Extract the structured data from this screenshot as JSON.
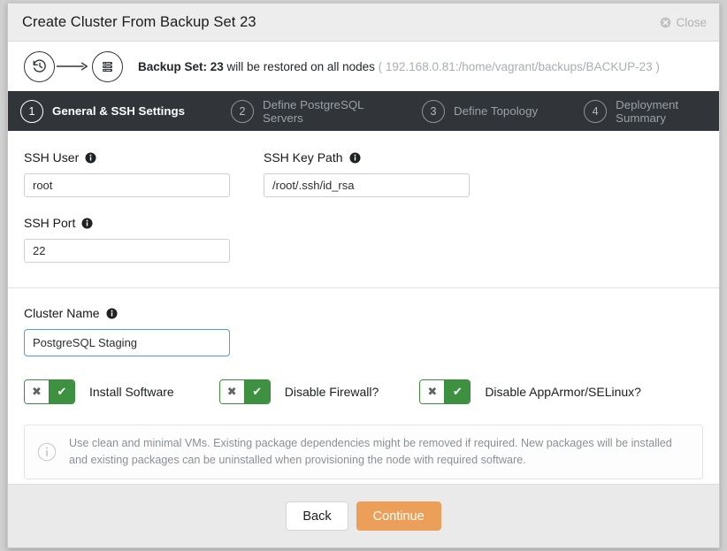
{
  "window": {
    "title": "Create Cluster From Backup Set 23",
    "close_label": "Close",
    "close_icon": "close-circle-icon"
  },
  "banner": {
    "restore_icon": "history-restore-icon",
    "server_icon": "server-stack-icon",
    "arrow_icon": "arrow-right-icon",
    "prefix": "Backup Set: 23",
    "middle": " will be restored on all nodes ",
    "path": "( 192.168.0.81:/home/vagrant/backups/BACKUP-23 )"
  },
  "steps": [
    {
      "num": "1",
      "label": "General & SSH Settings",
      "active": true
    },
    {
      "num": "2",
      "label": "Define PostgreSQL Servers",
      "active": false
    },
    {
      "num": "3",
      "label": "Define Topology",
      "active": false
    },
    {
      "num": "4",
      "label": "Deployment Summary",
      "active": false
    }
  ],
  "form": {
    "ssh_user": {
      "label": "SSH User",
      "value": "root",
      "info_icon": "info-icon"
    },
    "ssh_key_path": {
      "label": "SSH Key Path",
      "value": "/root/.ssh/id_rsa",
      "info_icon": "info-icon"
    },
    "ssh_port": {
      "label": "SSH Port",
      "value": "22",
      "info_icon": "info-icon"
    },
    "cluster_name": {
      "label": "Cluster Name",
      "value": "PostgreSQL Staging",
      "info_icon": "info-icon",
      "focused": true
    }
  },
  "toggles": [
    {
      "label": "Install Software",
      "off_glyph": "✖",
      "on_glyph": "✔",
      "state": "on"
    },
    {
      "label": "Disable Firewall?",
      "off_glyph": "✖",
      "on_glyph": "✔",
      "state": "on"
    },
    {
      "label": "Disable AppArmor/SELinux?",
      "off_glyph": "✖",
      "on_glyph": "✔",
      "state": "on"
    }
  ],
  "note": {
    "icon": "info-circle-outline-icon",
    "text": "Use clean and minimal VMs. Existing package dependencies might be removed if required. New packages will be installed and existing packages can be uninstalled when provisioning the node with required software."
  },
  "footer": {
    "back_label": "Back",
    "continue_label": "Continue"
  },
  "colors": {
    "accent_orange": "#eb9f58",
    "toggle_green": "#3f9142",
    "steps_bar": "#31353a",
    "focus_blue": "#4a9fd8"
  }
}
